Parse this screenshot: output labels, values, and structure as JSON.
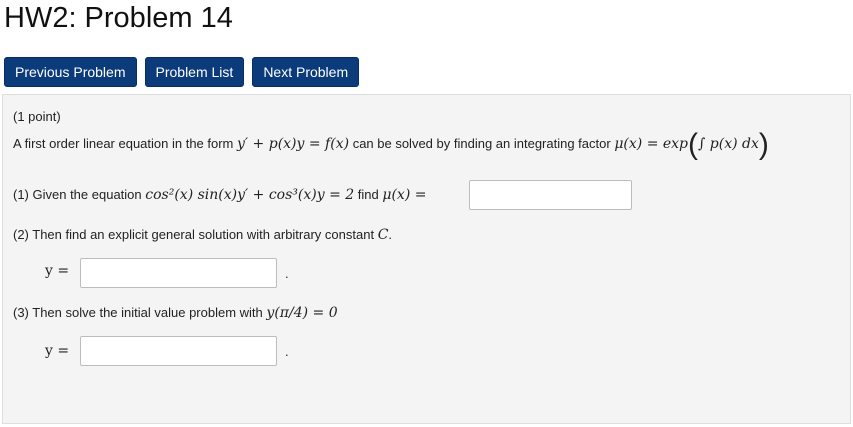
{
  "page": {
    "title": "HW2: Problem 14"
  },
  "nav": {
    "previous": "Previous Problem",
    "list": "Problem List",
    "next": "Next Problem"
  },
  "problem": {
    "points": "(1 point)",
    "intro_prefix": "A first order linear equation in the form",
    "intro_eq": "y′ + p(x)y = f(x)",
    "intro_mid": "can be solved by finding an integrating factor",
    "intro_mu": "μ(x) = exp",
    "intro_integral": "∫ p(x) dx",
    "part1_prefix": "(1) Given the equation",
    "part1_eq": "cos²(x) sin(x)y′ + cos³(x)y = 2",
    "part1_mid": "find",
    "part1_mu": "μ(x) =",
    "part2_text": "(2) Then find an explicit general solution with arbitrary constant",
    "part2_const": "C",
    "part2_end": ".",
    "answer2_label": "y =",
    "answer2_period": ".",
    "part3_prefix": "(3) Then solve the initial value problem with",
    "part3_eq": "y(π/4) = 0",
    "answer3_label": "y =",
    "answer3_period": "."
  }
}
